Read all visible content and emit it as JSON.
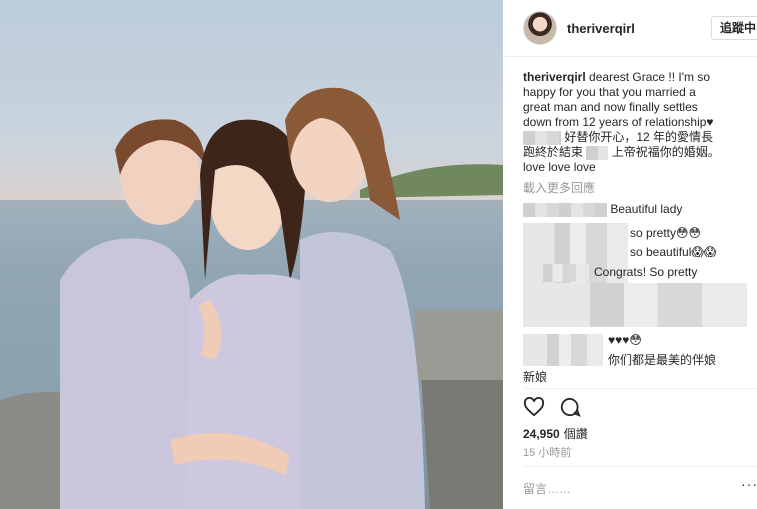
{
  "post": {
    "photo_icon": "photo-of-three-women-in-lavender-dresses",
    "header": {
      "username": "theriverqirl",
      "follow_label": "追蹤中"
    },
    "caption": {
      "username": "theriverqirl",
      "text_line1": "dearest Grace !! I'm so",
      "text_line2": "happy for you that you married a",
      "text_line3": "great man and now finally settles",
      "text_line4": "down from 12 years of relationship♥",
      "text_line5": "好替你开心，12 年的愛情長",
      "text_line6": "跑終於結束",
      "text_line6b": "上帝祝福你的婚姻。",
      "text_line7": "love love love"
    },
    "load_more": "載入更多回應",
    "comments": [
      {
        "text": "Beautiful lady"
      },
      {
        "text": "so pretty😳😳"
      },
      {
        "text": "so beautiful😱😱"
      },
      {
        "text": "Congrats! So pretty"
      },
      {
        "text": "♥♥♥😳"
      },
      {
        "text": "你们都是最美的伴娘"
      },
      {
        "text": "新娘"
      }
    ],
    "likes_count": "24,950",
    "likes_unit": "個讚",
    "timestamp": "15 小時前",
    "add_comment_placeholder": "留言……",
    "more_label": "···",
    "icons": [
      "heart-icon",
      "comment-icon",
      "more-options-icon"
    ]
  }
}
